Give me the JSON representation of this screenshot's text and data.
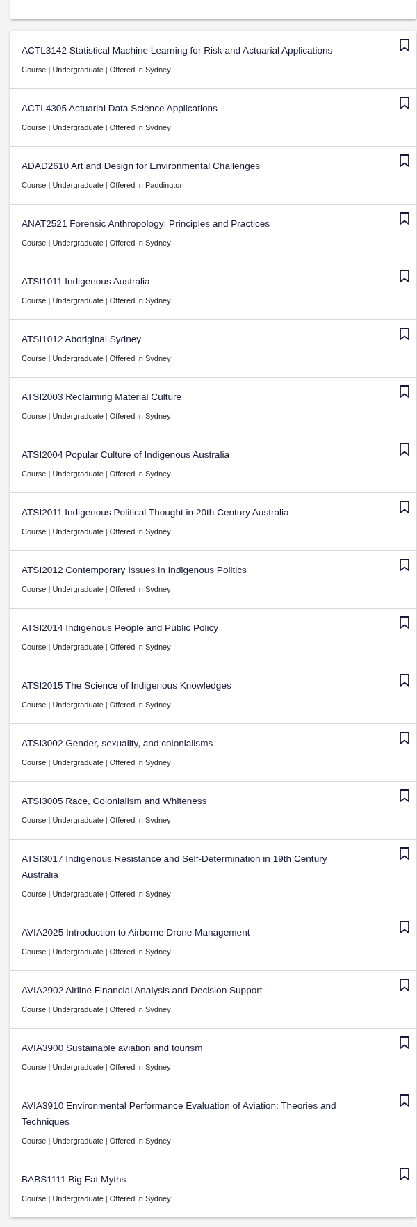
{
  "courses": [
    {
      "title": "ACTL3142 Statistical Machine Learning for Risk and Actuarial Applications",
      "details": "Course | Undergraduate | Offered in Sydney",
      "bookmarked": false
    },
    {
      "title": "ACTL4305 Actuarial Data Science Applications",
      "details": "Course | Undergraduate | Offered in Sydney",
      "bookmarked": false
    },
    {
      "title": "ADAD2610 Art and Design for Environmental Challenges",
      "details": "Course | Undergraduate | Offered in Paddington",
      "bookmarked": false
    },
    {
      "title": "ANAT2521 Forensic Anthropology: Principles and Practices",
      "details": "Course | Undergraduate | Offered in Sydney",
      "bookmarked": false
    },
    {
      "title": "ATSI1011 Indigenous Australia",
      "details": "Course | Undergraduate | Offered in Sydney",
      "bookmarked": false
    },
    {
      "title": "ATSI1012 Aboriginal Sydney",
      "details": "Course | Undergraduate | Offered in Sydney",
      "bookmarked": false
    },
    {
      "title": "ATSI2003 Reclaiming Material Culture",
      "details": "Course | Undergraduate | Offered in Sydney",
      "bookmarked": false
    },
    {
      "title": "ATSI2004 Popular Culture of Indigenous Australia",
      "details": "Course | Undergraduate | Offered in Sydney",
      "bookmarked": false
    },
    {
      "title": "ATSI2011 Indigenous Political Thought in 20th Century Australia",
      "details": "Course | Undergraduate | Offered in Sydney",
      "bookmarked": false
    },
    {
      "title": "ATSI2012 Contemporary Issues in Indigenous Politics",
      "details": "Course | Undergraduate | Offered in Sydney",
      "bookmarked": false
    },
    {
      "title": "ATSI2014 Indigenous People and Public Policy",
      "details": "Course | Undergraduate | Offered in Sydney",
      "bookmarked": false
    },
    {
      "title": "ATSI2015 The Science of Indigenous Knowledges",
      "details": "Course | Undergraduate | Offered in Sydney",
      "bookmarked": false
    },
    {
      "title": "ATSI3002 Gender, sexuality, and colonialisms",
      "details": "Course | Undergraduate | Offered in Sydney",
      "bookmarked": false
    },
    {
      "title": "ATSI3005 Race, Colonialism and Whiteness",
      "details": "Course | Undergraduate | Offered in Sydney",
      "bookmarked": false
    },
    {
      "title": "ATSI3017 Indigenous Resistance and Self-Determination in 19th Century Australia",
      "details": "Course | Undergraduate | Offered in Sydney",
      "bookmarked": false
    },
    {
      "title": "AVIA2025 Introduction to Airborne Drone Management",
      "details": "Course | Undergraduate | Offered in Sydney",
      "bookmarked": false
    },
    {
      "title": "AVIA2902 Airline Financial Analysis and Decision Support",
      "details": "Course | Undergraduate | Offered in Sydney",
      "bookmarked": false
    },
    {
      "title": "AVIA3900 Sustainable aviation and tourism",
      "details": "Course | Undergraduate | Offered in Sydney",
      "bookmarked": false
    },
    {
      "title": "AVIA3910 Environmental Performance Evaluation of Aviation: Theories and Techniques",
      "details": "Course | Undergraduate | Offered in Sydney",
      "bookmarked": false
    },
    {
      "title": "BABS1111 Big Fat Myths",
      "details": "Course | Undergraduate | Offered in Sydney",
      "bookmarked": false
    }
  ]
}
